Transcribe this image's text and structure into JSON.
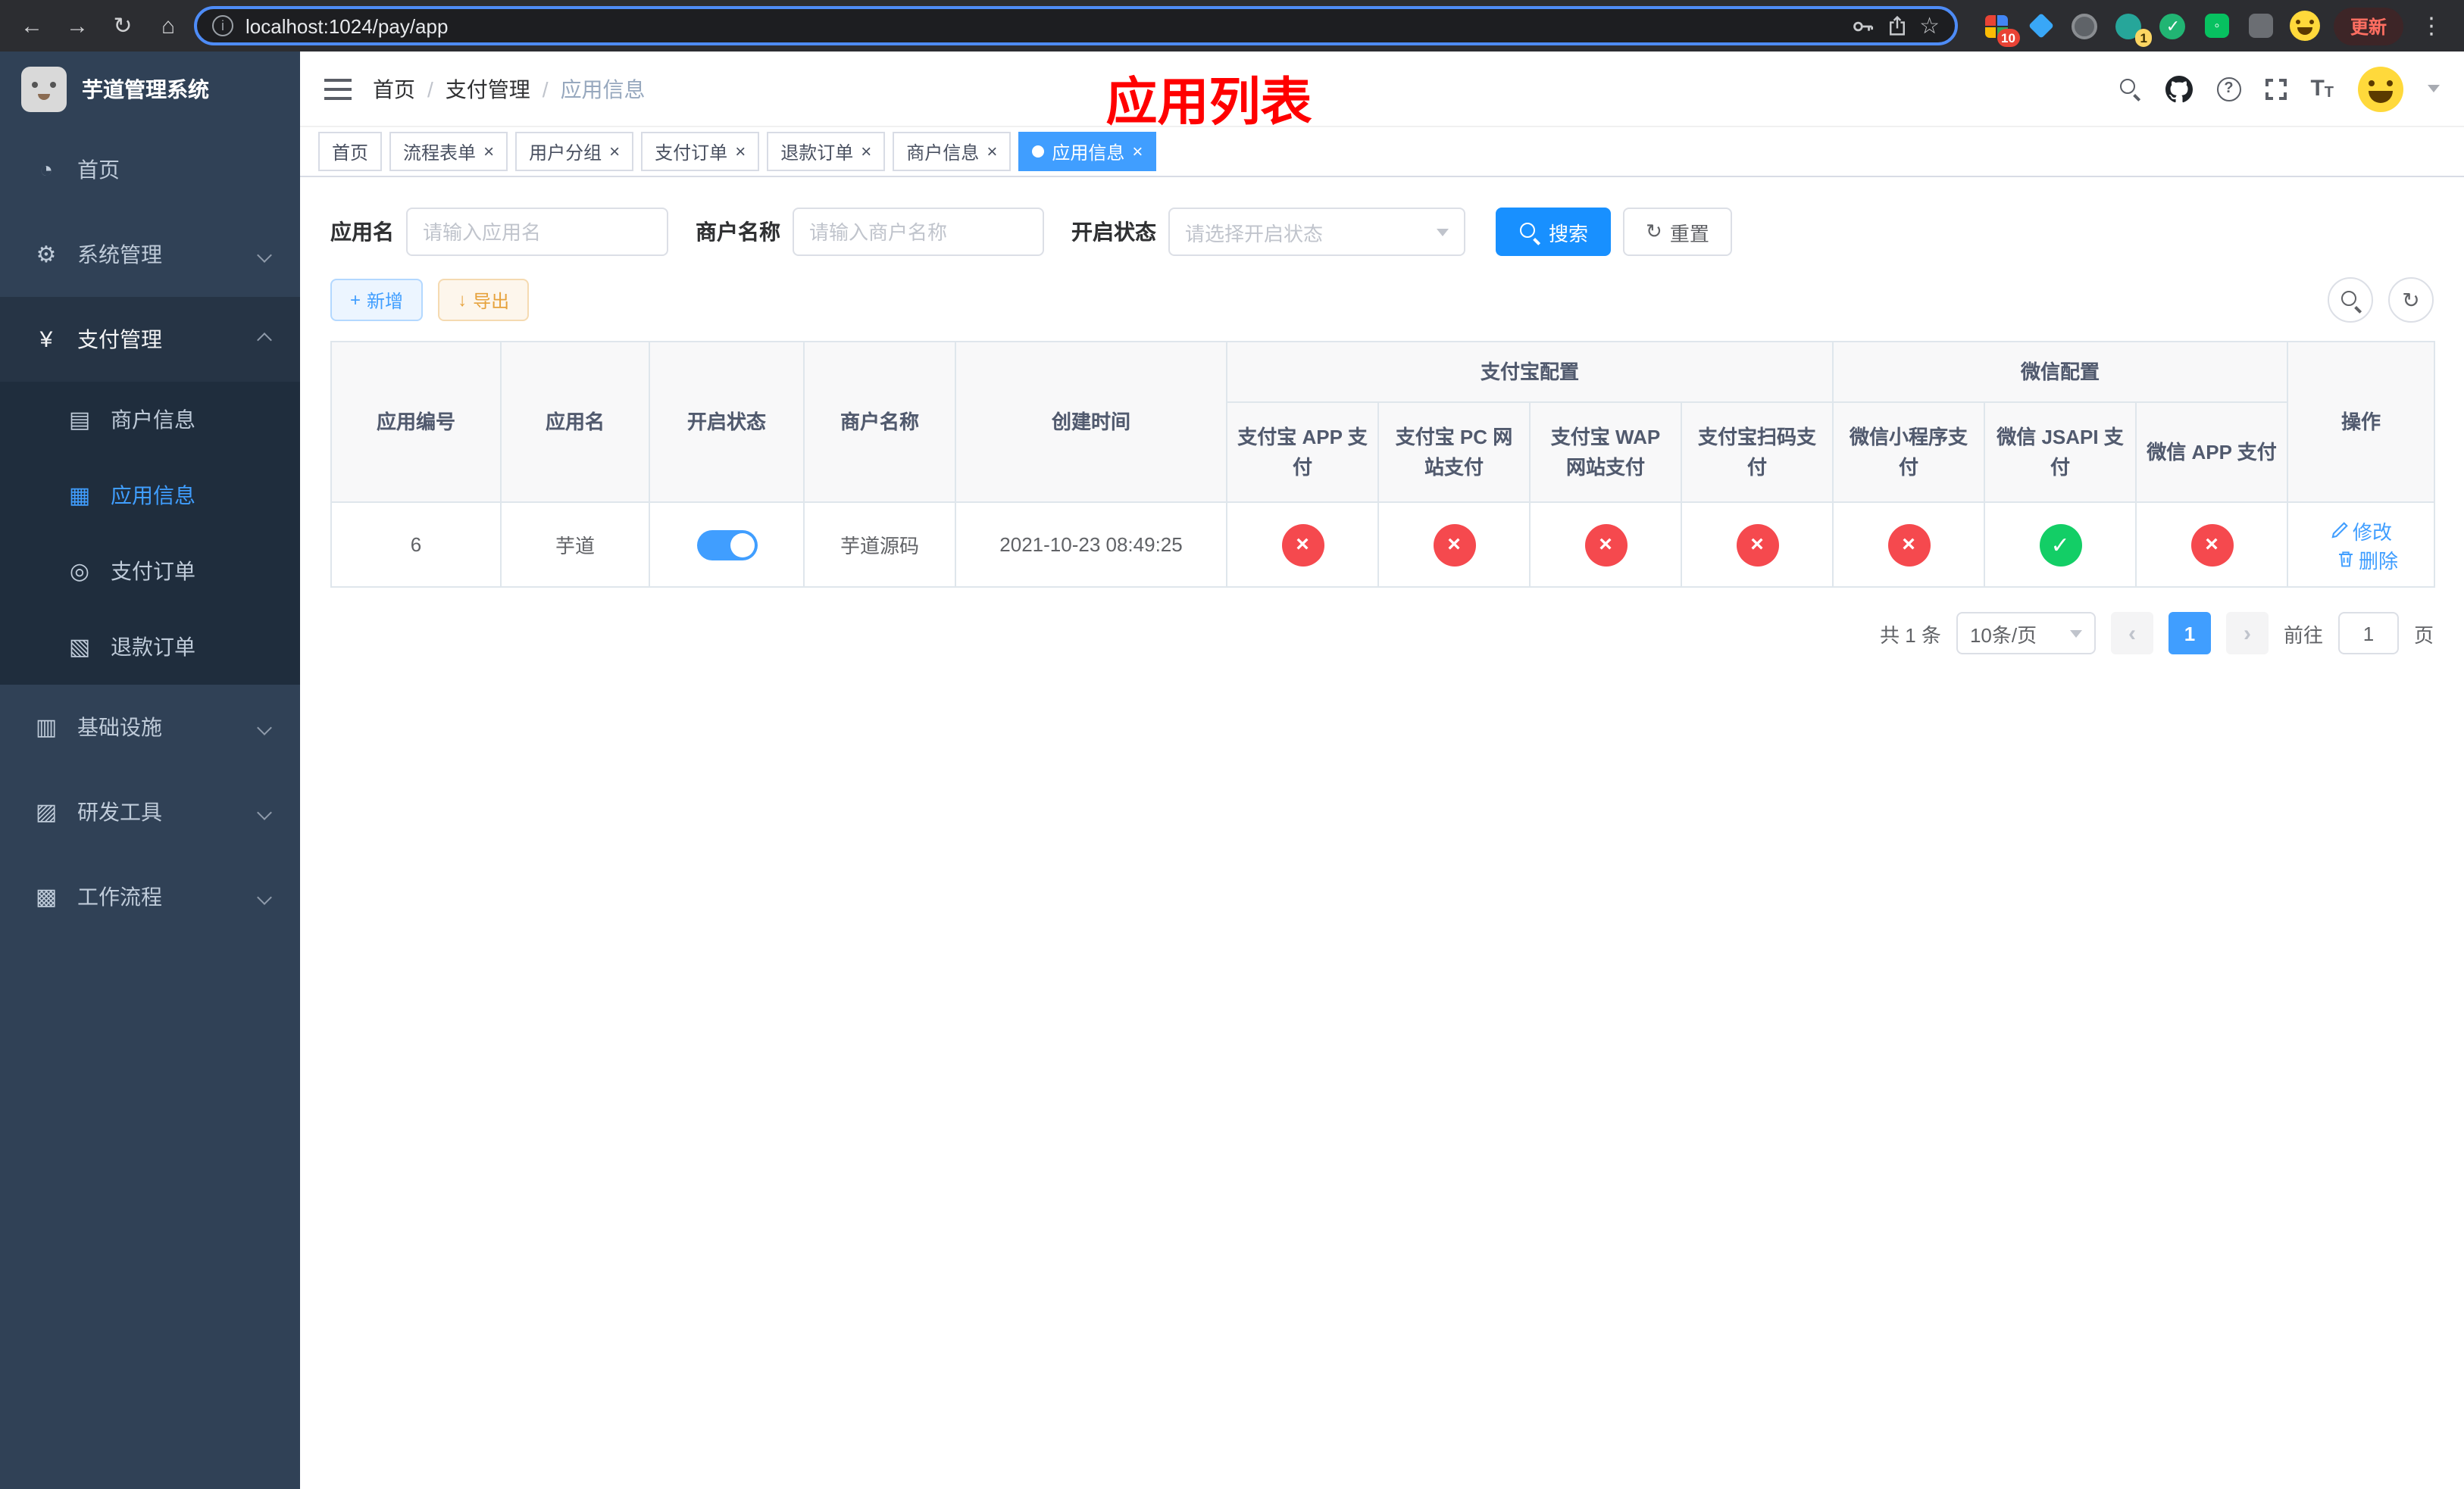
{
  "colors": {
    "primary": "#409eff",
    "search_button": "#1890ff",
    "danger": "#f5494e",
    "success": "#13ce66",
    "warning": "#e6a23c",
    "annotation": "#ff0000"
  },
  "icons": {
    "back": "←",
    "forward": "→",
    "reload": "↻",
    "home": "⌂",
    "star": "☆",
    "info": "i",
    "dots": "⋮",
    "check": "✓",
    "cross": "×",
    "close": "×",
    "dashboard": "◔",
    "gear": "⚙",
    "yen": "¥",
    "merchant": "▤",
    "appinfo": "▦",
    "payorder": "◎",
    "refundorder": "▧",
    "infra": "▥",
    "devtool": "▨",
    "workflow": "▩",
    "plus": "+",
    "download": "↓",
    "refresh": "↻",
    "prev": "‹",
    "next": "›",
    "chat": "◦"
  },
  "browser": {
    "url": "localhost:1024/pay/app",
    "update_label": "更新",
    "extension_badge_count": "10",
    "avatar_badge_count": "1"
  },
  "sidebar": {
    "title": "芋道管理系统",
    "items": [
      {
        "label": "首页"
      },
      {
        "label": "系统管理"
      },
      {
        "label": "支付管理"
      },
      {
        "label": "基础设施"
      },
      {
        "label": "研发工具"
      },
      {
        "label": "工作流程"
      }
    ],
    "pay_children": [
      {
        "label": "商户信息"
      },
      {
        "label": "应用信息"
      },
      {
        "label": "支付订单"
      },
      {
        "label": "退款订单"
      }
    ]
  },
  "navbar": {
    "breadcrumb": [
      {
        "label": "首页"
      },
      {
        "label": "支付管理"
      },
      {
        "label": "应用信息"
      }
    ],
    "annotation": "应用列表"
  },
  "tabs": [
    {
      "label": "首页"
    },
    {
      "label": "流程表单"
    },
    {
      "label": "用户分组"
    },
    {
      "label": "支付订单"
    },
    {
      "label": "退款订单"
    },
    {
      "label": "商户信息"
    },
    {
      "label": "应用信息"
    }
  ],
  "filters": {
    "app_name": {
      "label": "应用名",
      "placeholder": "请输入应用名",
      "value": ""
    },
    "merchant_name": {
      "label": "商户名称",
      "placeholder": "请输入商户名称",
      "value": ""
    },
    "status": {
      "label": "开启状态",
      "placeholder": "请选择开启状态"
    },
    "search_label": "搜索",
    "reset_label": "重置"
  },
  "toolbar": {
    "add_label": "新增",
    "export_label": "导出"
  },
  "table": {
    "simple_headers": [
      "应用编号",
      "应用名",
      "开启状态",
      "商户名称",
      "创建时间"
    ],
    "group_headers": [
      {
        "label": "支付宝配置",
        "children": [
          "支付宝 APP 支付",
          "支付宝 PC 网站支付",
          "支付宝 WAP 网站支付",
          "支付宝扫码支付"
        ]
      },
      {
        "label": "微信配置",
        "children": [
          "微信小程序支付",
          "微信 JSAPI 支付",
          "微信 APP 支付"
        ]
      }
    ],
    "action_header": "操作",
    "rows": [
      {
        "id": "6",
        "name": "芋道",
        "enabled": true,
        "merchant": "芋道源码",
        "created_at": "2021-10-23 08:49:25",
        "configs": [
          false,
          false,
          false,
          false,
          false,
          true,
          false
        ],
        "edit_label": "修改",
        "delete_label": "删除"
      }
    ]
  },
  "pagination": {
    "total_text": "共 1 条",
    "page_size": "10条/页",
    "current_page": "1",
    "goto_prefix": "前往",
    "goto_value": "1",
    "goto_suffix": "页"
  }
}
